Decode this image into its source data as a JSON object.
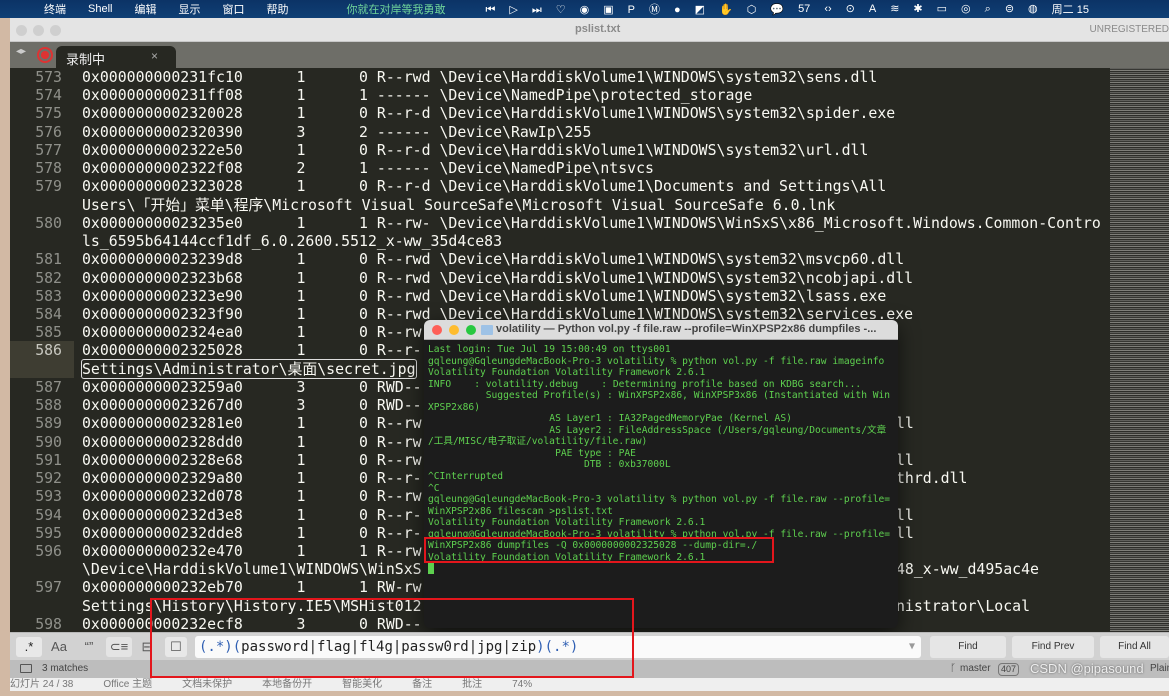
{
  "menubar": {
    "apple": "",
    "items": [
      "终端",
      "Shell",
      "编辑",
      "显示",
      "窗口",
      "帮助"
    ],
    "song": "你就在对岸等我勇敢",
    "icons": [
      "⏮",
      "▷",
      "⏭",
      "♡",
      "◉",
      "▣",
      "P",
      "Ⓜ",
      "●",
      "◩",
      "✋",
      "⬡",
      "💬"
    ],
    "wechat_count": "57",
    "icons2": [
      "‹›",
      "⊙",
      "A",
      "≋",
      "✱",
      "▭",
      "◎",
      "⌕",
      "⊜",
      "◍"
    ],
    "clock": "周二 15"
  },
  "window": {
    "title": "pslist.txt",
    "unregistered": "UNREGISTERED",
    "tab_label": "录制中",
    "tab_close": "×",
    "nav": "◂▸"
  },
  "editor": {
    "rows": [
      {
        "n": "573",
        "t": "0x000000000231fc10      1      0 R--rwd \\Device\\HarddiskVolume1\\WINDOWS\\system32\\sens.dll"
      },
      {
        "n": "574",
        "t": "0x000000000231ff08      1      1 ------ \\Device\\NamedPipe\\protected_storage"
      },
      {
        "n": "575",
        "t": "0x0000000002320028      1      0 R--r-d \\Device\\HarddiskVolume1\\WINDOWS\\system32\\spider.exe"
      },
      {
        "n": "576",
        "t": "0x0000000002320390      3      2 ------ \\Device\\RawIp\\255"
      },
      {
        "n": "577",
        "t": "0x0000000002322e50      1      0 R--r-d \\Device\\HarddiskVolume1\\WINDOWS\\system32\\url.dll"
      },
      {
        "n": "578",
        "t": "0x0000000002322f08      2      1 ------ \\Device\\NamedPipe\\ntsvcs"
      },
      {
        "n": "579",
        "t": "0x0000000002323028      1      0 R--r-d \\Device\\HarddiskVolume1\\Documents and Settings\\All"
      },
      {
        "n": "",
        "t": "Users\\「开始」菜单\\程序\\Microsoft Visual SourceSafe\\Microsoft Visual SourceSafe 6.0.lnk"
      },
      {
        "n": "580",
        "t": "0x00000000023235e0      1      1 R--rw- \\Device\\HarddiskVolume1\\WINDOWS\\WinSxS\\x86_Microsoft.Windows.Common-Contro"
      },
      {
        "n": "",
        "t": "ls_6595b64144ccf1df_6.0.2600.5512_x-ww_35d4ce83"
      },
      {
        "n": "581",
        "t": "0x00000000023239d8      1      0 R--rwd \\Device\\HarddiskVolume1\\WINDOWS\\system32\\msvcp60.dll"
      },
      {
        "n": "582",
        "t": "0x0000000002323b68      1      0 R--rwd \\Device\\HarddiskVolume1\\WINDOWS\\system32\\ncobjapi.dll"
      },
      {
        "n": "583",
        "t": "0x0000000002323e90      1      0 R--rwd \\Device\\HarddiskVolume1\\WINDOWS\\system32\\lsass.exe"
      },
      {
        "n": "584",
        "t": "0x0000000002323f90      1      0 R--rwd \\Device\\HarddiskVolume1\\WINDOWS\\system32\\services.exe"
      },
      {
        "n": "585",
        "t": "0x0000000002324ea0      1      0 R--rw"
      },
      {
        "n": "586",
        "t": "0x0000000002325028      1      0 R--r-",
        "current": true
      },
      {
        "n": "",
        "m": "Settings\\Administrator\\桌面\\secret.jpg",
        "current": true
      },
      {
        "n": "587",
        "t": "0x00000000023259a0      3      0 RWD--"
      },
      {
        "n": "588",
        "t": "0x00000000023267d0      3      0 RWD--"
      },
      {
        "n": "589",
        "t": "0x00000000023281e0      1      0 R--rw",
        "r": "ll"
      },
      {
        "n": "590",
        "t": "0x0000000002328dd0      1      0 R--rw"
      },
      {
        "n": "591",
        "t": "0x0000000002328e68      1      0 R--rw",
        "r": "ll"
      },
      {
        "n": "592",
        "t": "0x0000000002329a80      1      0 R--r-",
        "r": "thrd.dll"
      },
      {
        "n": "593",
        "t": "0x000000000232d078      1      0 R--rw"
      },
      {
        "n": "594",
        "t": "0x000000000232d3e8      1      0 R--r-",
        "r": "ll"
      },
      {
        "n": "595",
        "t": "0x000000000232dde8      1      0 R--r-",
        "r": "ll"
      },
      {
        "n": "596",
        "t": "0x000000000232e470      1      1 R--rw"
      },
      {
        "n": "",
        "t": "\\Device\\HarddiskVolume1\\WINDOWS\\WinSxS",
        "r": "48_x-ww_d495ac4e"
      },
      {
        "n": "597",
        "t": "0x000000000232eb70      1      1 RW-rw"
      },
      {
        "n": "",
        "t": "Settings\\History\\History.IE5\\MSHist012",
        "r": "nistrator\\Local"
      },
      {
        "n": "598",
        "t": "0x000000000232ecf8      3      0 RWD--"
      }
    ]
  },
  "terminal": {
    "title": "volatility — Python vol.py -f file.raw --profile=WinXPSP2x86 dumpfiles -...",
    "lines": [
      "Last login: Tue Jul 19 15:00:49 on ttys001",
      "gqleung@GqleungdeMacBook-Pro-3 volatility % python vol.py -f file.raw imageinfo",
      "Volatility Foundation Volatility Framework 2.6.1",
      "INFO    : volatility.debug    : Determining profile based on KDBG search...",
      "          Suggested Profile(s) : WinXPSP2x86, WinXPSP3x86 (Instantiated with Win",
      "XPSP2x86)",
      "                     AS Layer1 : IA32PagedMemoryPae (Kernel AS)",
      "                     AS Layer2 : FileAddressSpace (/Users/gqleung/Documents/文章",
      "/工具/MISC/电子取证/volatility/file.raw)",
      "                      PAE type : PAE",
      "                           DTB : 0xb37000L",
      "^CInterrupted",
      "^C",
      "gqleung@GqleungdeMacBook-Pro-3 volatility % python vol.py -f file.raw --profile=",
      "WinXPSP2x86 filescan >pslist.txt",
      "Volatility Foundation Volatility Framework 2.6.1",
      "gqleung@GqleungdeMacBook-Pro-3 volatility % python vol.py -f file.raw --profile=",
      "WinXPSP2x86 dumpfiles -Q 0x0000000002325028 --dump-dir=./",
      "Volatility Foundation Volatility Framework 2.6.1"
    ]
  },
  "find": {
    "regex_btn": ".*",
    "case_btn": "Aa",
    "word_btn": "“”",
    "wrap_btn": "⊂≡",
    "selection_btn": "⊟",
    "highlight_btn": "☐",
    "query_open": "(.*)(",
    "query_mid": "password|flag|fl4g|passw0rd|jpg|zip",
    "query_close": ")(.*)",
    "dropdown": "▼",
    "find": "Find",
    "find_prev": "Find Prev",
    "find_all": "Find All"
  },
  "status": {
    "matches": "3 matches",
    "branch": "master",
    "branch_count": "407",
    "watermark": "CSDN @pipasound",
    "syntax": "Plain Te"
  },
  "wps": {
    "items": [
      "幻灯片 24 / 38",
      "Office 主题",
      "文档未保护",
      "本地备份开",
      "智能美化",
      "备注",
      "批注",
      "74%"
    ]
  },
  "colors": {
    "editor_bg": "#272822",
    "terminal_green": "#5ed04f",
    "highlight_box": "#e3161c"
  }
}
